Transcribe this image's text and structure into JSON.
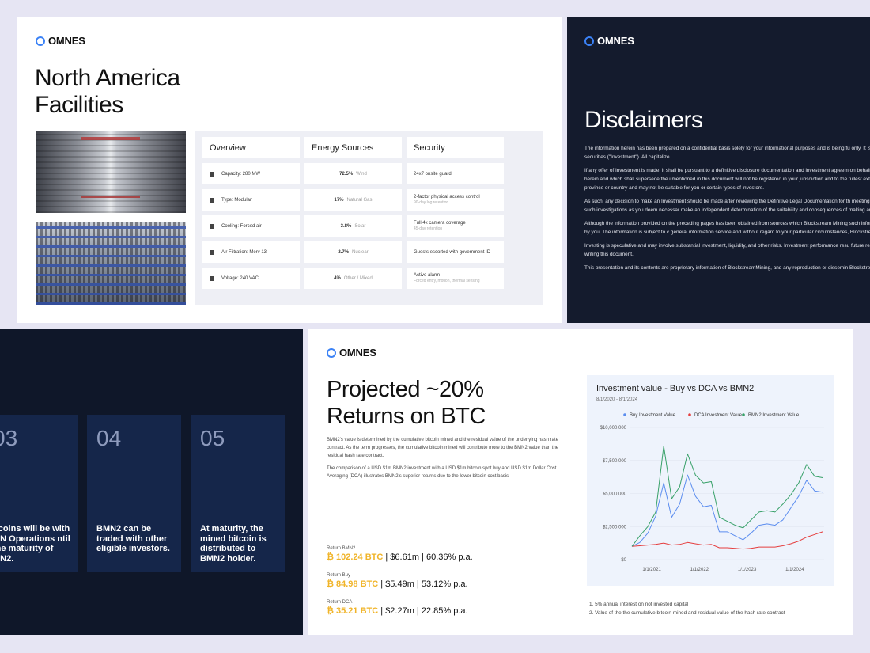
{
  "brand": "OMNES",
  "facilities": {
    "title_line1": "North America",
    "title_line2": "Facilities",
    "headers": [
      "Overview",
      "Energy Sources",
      "Security"
    ],
    "overview": [
      "Capacity: 280 MW",
      "Type: Modular",
      "Cooling: Forced air",
      "Air Filtration: Merv 13",
      "Voltage: 240 VAC"
    ],
    "overview_icons": [
      "building-icon",
      "modular-icon",
      "fan-icon",
      "filter-icon",
      "bolt-icon"
    ],
    "energy": [
      {
        "pct": "72.5%",
        "src": "Wind"
      },
      {
        "pct": "17%",
        "src": "Natural Gas"
      },
      {
        "pct": "3.8%",
        "src": "Solar"
      },
      {
        "pct": "2.7%",
        "src": "Nuclear"
      },
      {
        "pct": "4%",
        "src": "Other / Mixed"
      }
    ],
    "security": [
      {
        "main": "24x7 onsite guard",
        "sub": ""
      },
      {
        "main": "2-factor physical access control",
        "sub": "90-day log retention"
      },
      {
        "main": "Full 4k camera coverage",
        "sub": "45-day retention"
      },
      {
        "main": "Guests escorted with government ID",
        "sub": ""
      },
      {
        "main": "Active alarm",
        "sub": "Forced entry, motion, thermal sensing"
      }
    ]
  },
  "disclaimers": {
    "title": "Disclaimers",
    "paragraphs": [
      "The information herein has been prepared on a confidential basis solely for your informational purposes and is being fu only. It is not an offer to buy or sell or a solicitation of an offer to buy or sell any securities (\"Investment\"). All capitalize",
      "If any offer of Investment is made, it shall be pursuant to a definitive disclosure documentation and investment agreem on behalf of the Issuer, which would contain material information not contained herein and which shall supersede the i mentioned in this document will not be registered in your jurisdiction and to the fullest extent possible any such offer w eligible for sale or investment in your province or country and may not be suitable for you or certain types of investors.",
      "As such, any decision to make an Investment should be made after reviewing the Definitive Legal Documentation for th meeting any relevant regulatory requirements and that you have conducted such investigations as you deem necessar make an independent determination of the suitability and consequences of making an Investment.",
      "Although the information provided on the preceding pages has been obtained from sources which Blockstream Mining such information may be incomplete or condensed and must not be relied upon by you. The information is subject to c general information service and without regard to your particular circumstances, Blockstream Mining shall not be liable",
      "Investing is speculative and may involve substantial investment, liquidity, and other risks. Investment performance resu future results. There is no secondary market for the Investment at the time of writing this document.",
      "This presentation and its contents are proprietary information of BlockstreamMining, and any reproduction or dissemin Blockstream Mining is prohibited."
    ]
  },
  "steps": [
    {
      "num": "03",
      "text": "itcoins will be with MN Operations ntil the maturity of MN2."
    },
    {
      "num": "04",
      "text": "BMN2 can be traded with other eligible investors."
    },
    {
      "num": "05",
      "text": "At maturity, the mined bitcoin is distributed to BMN2 holder."
    }
  ],
  "returns": {
    "title_line1": "Projected ~20%",
    "title_line2": "Returns on BTC",
    "desc": [
      "BMN2's value is determined by the cumulative bitcoin mined and the residual value of the underlying hash rate contract. As the term progresses, the cumulative bitcoin mined will contribute more to the BMN2 value than the residual hash rate contract.",
      "The comparison of a USD $1m BMN2 investment with a USD $1m bitcoin spot buy and USD $1m Dollar Cost Averaging (DCA) illustrates BMN2's superior returns due to the lower bitcoin cost basis"
    ],
    "items": [
      {
        "label": "Return BMN2",
        "btc": "₿ 102.24 BTC",
        "rest": " | $6.61m | 60.36% p.a."
      },
      {
        "label": "Return Buy",
        "btc": "₿ 84.98 BTC",
        "rest": " | $5.49m | 53.12% p.a."
      },
      {
        "label": "Return DCA",
        "btc": "₿ 35.21 BTC",
        "rest": " | $2.27m | 22.85% p.a."
      }
    ],
    "notes": [
      "1.  5% annual interest on not invested capital",
      "2.  Value of the the cumulative bitcoin mined and residual value of the hash rate contract"
    ]
  },
  "chart_data": {
    "type": "line",
    "title": "Investment value - Buy vs DCA vs BMN2",
    "subtitle": "8/1/2020 - 8/1/2024",
    "x": [
      "2020-08",
      "2020-10",
      "2020-12",
      "2021-02",
      "2021-04",
      "2021-06",
      "2021-08",
      "2021-10",
      "2021-12",
      "2022-02",
      "2022-04",
      "2022-06",
      "2022-08",
      "2022-10",
      "2022-12",
      "2023-02",
      "2023-04",
      "2023-06",
      "2023-08",
      "2023-10",
      "2023-12",
      "2024-02",
      "2024-04",
      "2024-06",
      "2024-08"
    ],
    "x_ticks": [
      "1/1/2021",
      "1/1/2022",
      "1/1/2023",
      "1/1/2024"
    ],
    "y_ticks": [
      "$0",
      "$2,500,000",
      "$5,000,000",
      "$7,500,000",
      "$10,000,000"
    ],
    "ylim": [
      0,
      10000000
    ],
    "legend_position": "top",
    "series": [
      {
        "name": "Buy Investment Value",
        "color": "#5b8def",
        "values": [
          1000000,
          1300000,
          2000000,
          3300000,
          5800000,
          3200000,
          4200000,
          6400000,
          4800000,
          4000000,
          4100000,
          2100000,
          2100000,
          1800000,
          1500000,
          2000000,
          2600000,
          2700000,
          2600000,
          3000000,
          3900000,
          4800000,
          6000000,
          5200000,
          5100000
        ]
      },
      {
        "name": "DCA Investment Value",
        "color": "#e53e3e",
        "values": [
          1000000,
          1050000,
          1100000,
          1150000,
          1250000,
          1100000,
          1150000,
          1300000,
          1200000,
          1100000,
          1150000,
          900000,
          900000,
          850000,
          800000,
          850000,
          950000,
          950000,
          950000,
          1050000,
          1200000,
          1400000,
          1700000,
          1900000,
          2100000
        ]
      },
      {
        "name": "BMN2 Investment Value",
        "color": "#38a169",
        "values": [
          1000000,
          1800000,
          2500000,
          3600000,
          8600000,
          4600000,
          5500000,
          8000000,
          6400000,
          5800000,
          5900000,
          3200000,
          2900000,
          2600000,
          2400000,
          3000000,
          3600000,
          3700000,
          3600000,
          4200000,
          4900000,
          5800000,
          7200000,
          6300000,
          6200000
        ]
      }
    ]
  }
}
